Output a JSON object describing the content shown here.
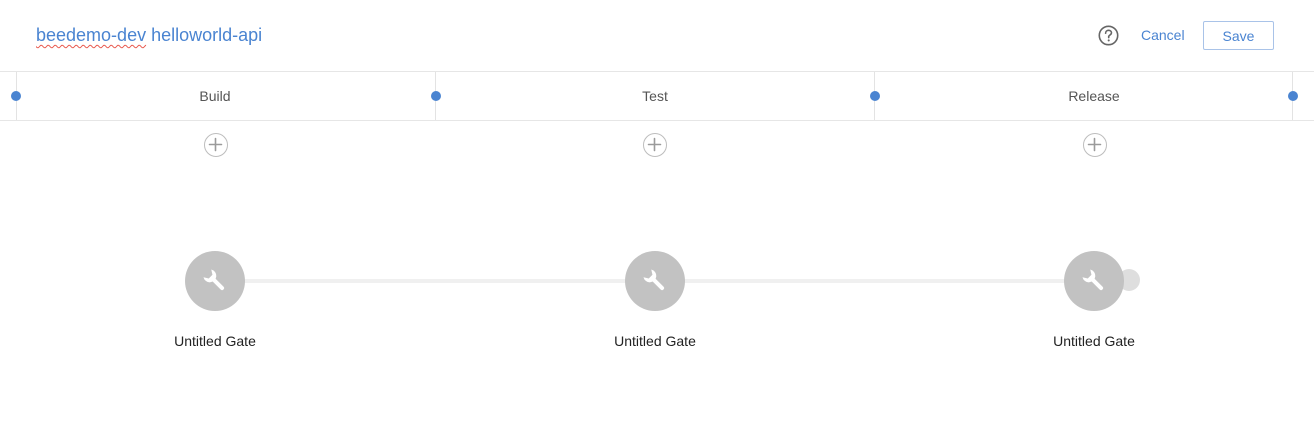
{
  "header": {
    "title_org": "beedemo-dev",
    "title_project": "helloworld-api",
    "help_icon": "help-circle-icon",
    "cancel_label": "Cancel",
    "save_label": "Save"
  },
  "stages": [
    {
      "label": "Build",
      "gate_label": "Untitled Gate",
      "add_icon": "plus-circle-icon",
      "gate_icon": "wrench-icon"
    },
    {
      "label": "Test",
      "gate_label": "Untitled Gate",
      "add_icon": "plus-circle-icon",
      "gate_icon": "wrench-icon"
    },
    {
      "label": "Release",
      "gate_label": "Untitled Gate",
      "add_icon": "plus-circle-icon",
      "gate_icon": "wrench-icon"
    }
  ],
  "colors": {
    "accent": "#4a84d1",
    "gate": "#c2c2c2",
    "connector": "#f0f0f0",
    "spellcheck_underline": "#e8574c"
  }
}
